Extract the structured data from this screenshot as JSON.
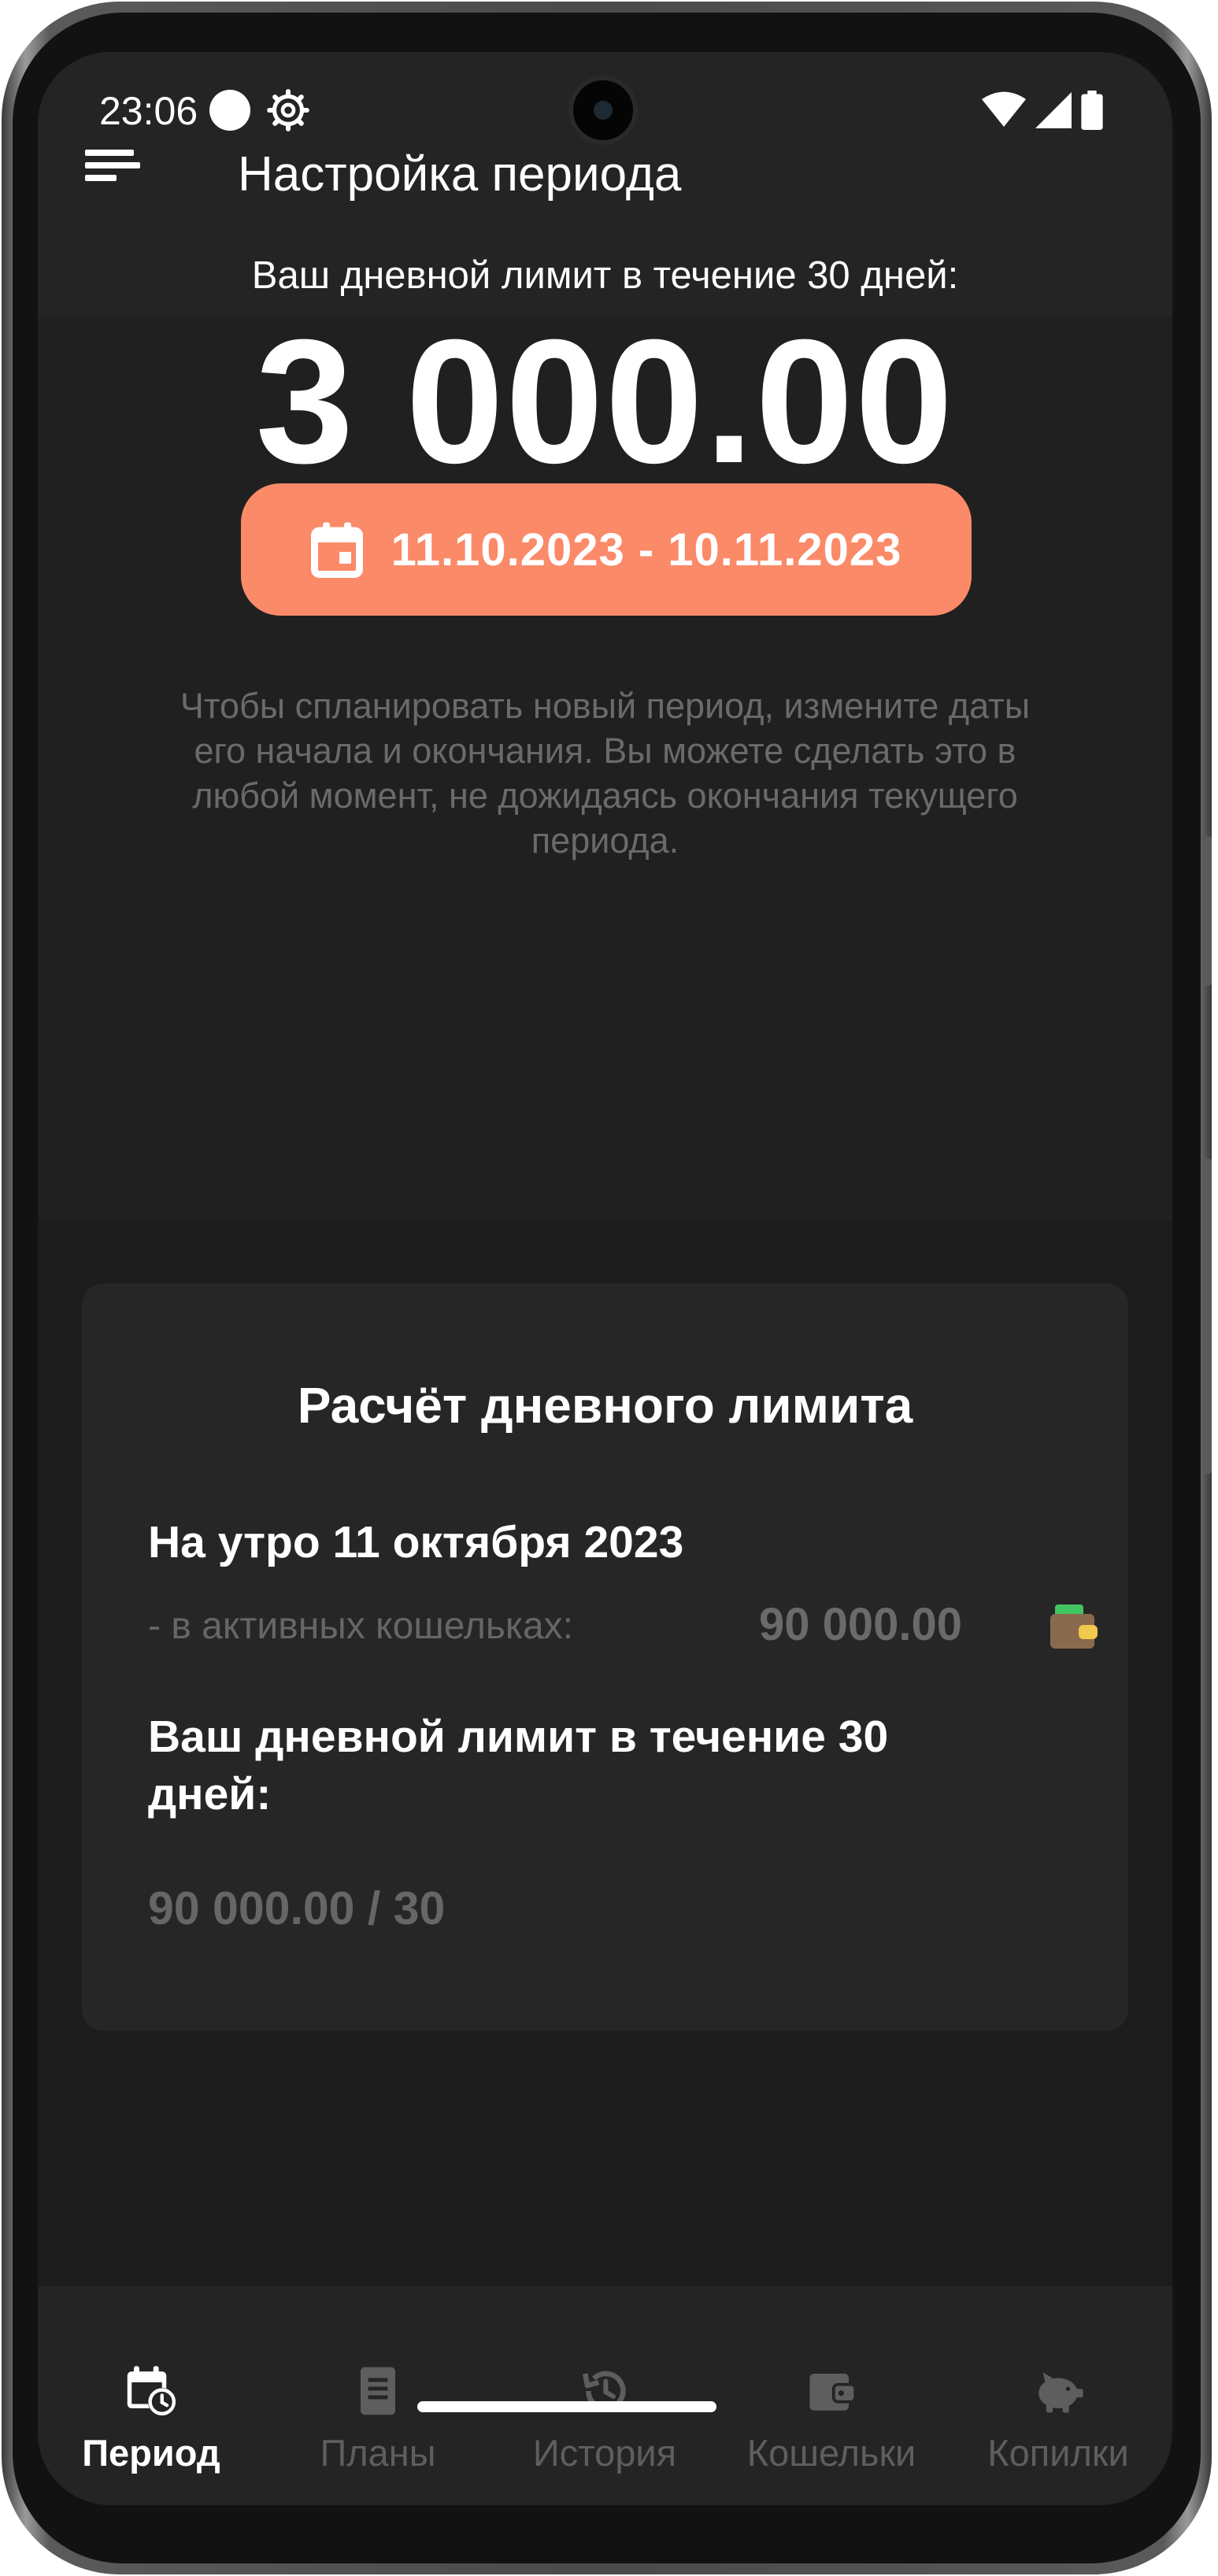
{
  "status_bar": {
    "time": "23:06",
    "icons": [
      "circle-notification-icon",
      "gear-icon",
      "wifi-icon",
      "cellular-signal-icon",
      "battery-icon"
    ]
  },
  "app_bar": {
    "menu_icon": "menu-icon",
    "title": "Настройка периода"
  },
  "summary": {
    "caption": "Ваш дневной лимит в течение 30 дней:",
    "daily_limit": "3 000.00",
    "period_button": {
      "icon": "calendar-icon",
      "label": "11.10.2023 - 10.11.2023"
    },
    "hint": "Чтобы спланировать новый период, измените даты его начала и окончания. Вы можете сделать это в любой момент, не дожидаясь окончания текущего периода."
  },
  "calculation": {
    "title": "Расчёт дневного лимита",
    "date_line": "На утро 11 октября 2023",
    "wallets_label": "- в активных кошельках:",
    "wallets_value": "90 000.00",
    "wallets_icon": "wallet-icon",
    "limit_label": "Ваш дневной лимит в течение 30 дней:",
    "formula": "90 000.00 / 30"
  },
  "bottom_nav": {
    "items": [
      {
        "label": "Период",
        "icon": "calendar-clock-icon",
        "active": true
      },
      {
        "label": "Планы",
        "icon": "document-icon",
        "active": false
      },
      {
        "label": "История",
        "icon": "history-icon",
        "active": false
      },
      {
        "label": "Кошельки",
        "icon": "wallet-icon",
        "active": false
      },
      {
        "label": "Копилки",
        "icon": "piggy-bank-icon",
        "active": false
      }
    ]
  },
  "colors": {
    "accent": "#fb8a69",
    "background": "#1c1c1c",
    "card": "#262626",
    "muted_text": "#666666"
  }
}
